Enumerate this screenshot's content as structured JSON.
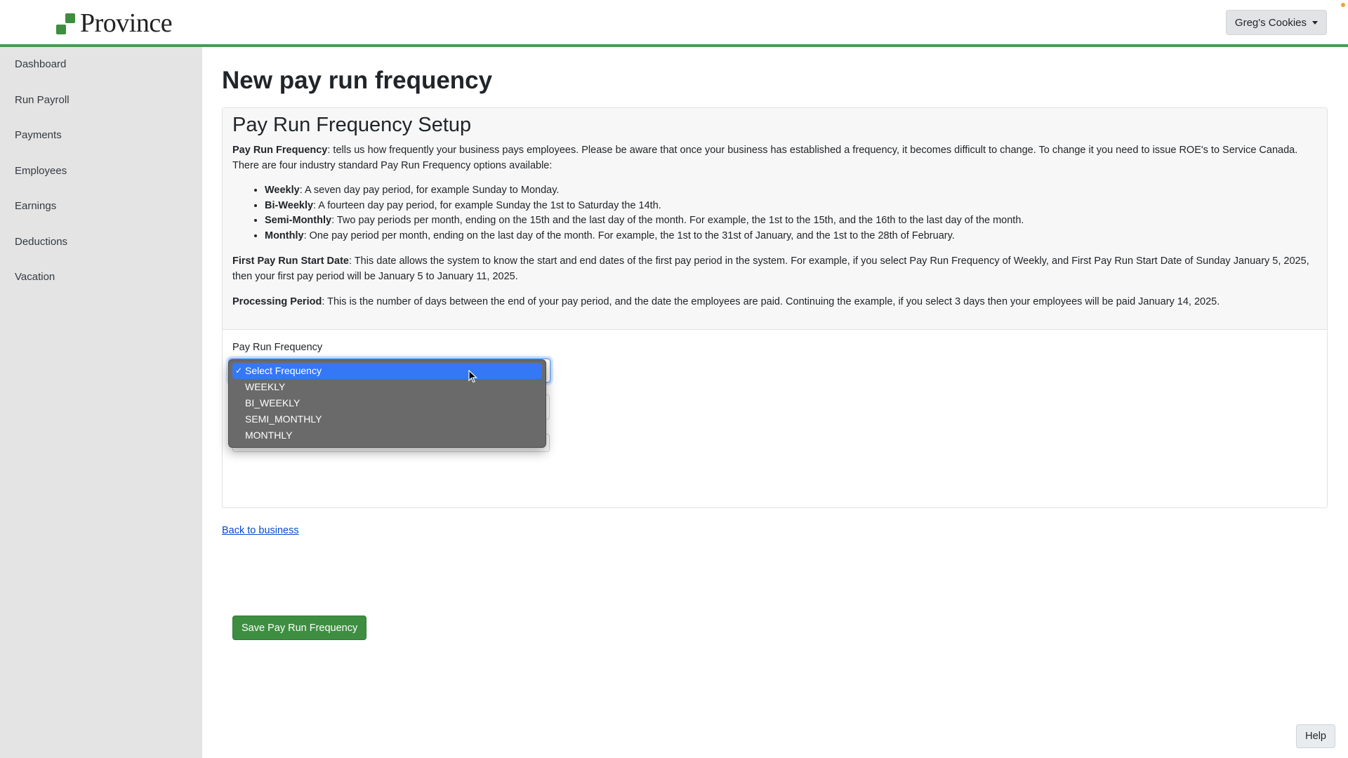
{
  "header": {
    "logo_text": "Province",
    "account_button": "Greg's Cookies"
  },
  "sidebar": {
    "items": [
      {
        "label": "Dashboard"
      },
      {
        "label": "Run Payroll"
      },
      {
        "label": "Payments"
      },
      {
        "label": "Employees"
      },
      {
        "label": "Earnings"
      },
      {
        "label": "Deductions"
      },
      {
        "label": "Vacation"
      }
    ]
  },
  "main": {
    "title": "New pay run frequency",
    "card": {
      "heading": "Pay Run Frequency Setup",
      "intro_term": "Pay Run Frequency",
      "intro_text": ": tells us how frequently your business pays employees. Please be aware that once your business has established a frequency, it becomes difficult to change. To change it you need to issue ROE's to Service Canada. There are four industry standard Pay Run Frequency options available:",
      "options_info": [
        {
          "term": "Weekly",
          "text": ": A seven day pay period, for example Sunday to Monday."
        },
        {
          "term": "Bi-Weekly",
          "text": ": A fourteen day pay period, for example Sunday the 1st to Saturday the 14th."
        },
        {
          "term": "Semi-Monthly",
          "text": ": Two pay periods per month, ending on the 15th and the last day of the month. For example, the 1st to the 15th, and the 16th to the last day of the month."
        },
        {
          "term": "Monthly",
          "text": ": One pay period per month, ending on the last day of the month. For example, the 1st to the 31st of January, and the 1st to the 28th of February."
        }
      ],
      "start_date_term": "First Pay Run Start Date",
      "start_date_text": ": This date allows the system to know the start and end dates of the first pay period in the system. For example, if you select Pay Run Frequency of Weekly, and First Pay Run Start Date of Sunday January 5, 2025, then your first pay period will be January 5 to January 11, 2025.",
      "processing_term": "Processing Period",
      "processing_text": ": This is the number of days between the end of your pay period, and the date the employees are paid. Continuing the example, if you select 3 days then your employees will be paid January 14, 2025.",
      "field_label": "Pay Run Frequency",
      "dropdown": {
        "selected": "Select Frequency",
        "options": [
          "Select Frequency",
          "WEEKLY",
          "BI_WEEKLY",
          "SEMI_MONTHLY",
          "MONTHLY"
        ]
      },
      "save_button": "Save Pay Run Frequency"
    },
    "back_link": "Back to business"
  },
  "help_button": "Help",
  "colors": {
    "brand_green": "#3e8e41",
    "header_border": "#4a9a4f",
    "sidebar_bg": "#e4e4e4",
    "dropdown_highlight": "#3478f6"
  }
}
